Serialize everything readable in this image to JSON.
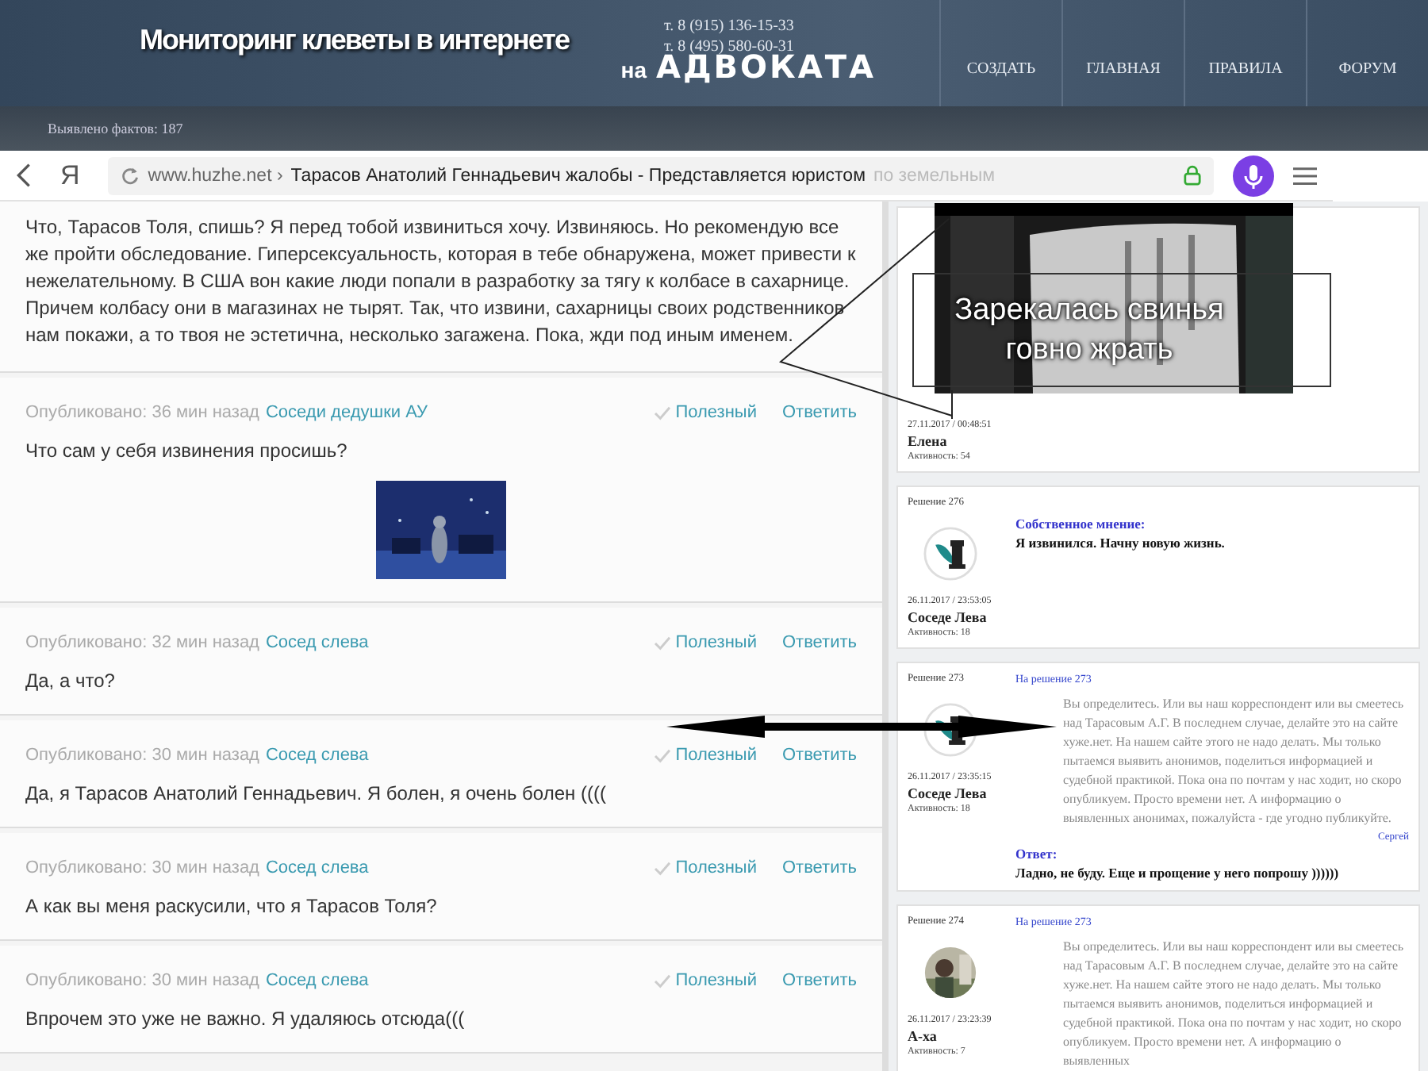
{
  "header": {
    "title": "Мониторинг клеветы в интернете",
    "subtitle_prefix": "на",
    "subtitle": "АДВОКАТА",
    "phones": [
      "т. 8 (915) 136-15-33",
      "т. 8 (495) 580-60-31"
    ],
    "nav": [
      {
        "label": "СОЗДАТЬ"
      },
      {
        "label": "ГЛАВНАЯ"
      },
      {
        "label": "ПРАВИЛА"
      },
      {
        "label": "ФОРУМ"
      }
    ]
  },
  "stats_bar": {
    "text": "Выявлено фактов: 187"
  },
  "browser": {
    "logo": "Я",
    "domain": "www.huzhe.net ›",
    "page_title": "Тарасов Анатолий Геннадьевич жалобы - Представляется юристом",
    "page_title_faded": "по земельным"
  },
  "excerpt": "Что, Тарасов Толя, спишь? Я перед тобой извиниться хочу. Извиняюсь. Но рекомендую все же пройти обследование. Гиперсексуальность, которая в тебе обнаружена, может привести к нежелательному. В США вон какие люди попали в разработку за тягу к колбасе в сахарнице. Причем колбасу они в магазинах не тырят. Так, что извини, сахарницы своих родственников нам покажи, а то твоя не эстетична, несколько загажена. Пока, жди под иным именем.",
  "comments": [
    {
      "published": "Опубликовано: 36 мин назад",
      "author": "Соседи дедушки АУ",
      "useful": "Полезный",
      "reply": "Ответить",
      "text": "Что сам у себя извинения просишь?"
    },
    {
      "published": "Опубликовано: 32 мин назад",
      "author": "Сосед слева",
      "useful": "Полезный",
      "reply": "Ответить",
      "text": "Да, а что?"
    },
    {
      "published": "Опубликовано: 30 мин назад",
      "author": "Сосед слева",
      "useful": "Полезный",
      "reply": "Ответить",
      "text": "Да, я Тарасов Анатолий Геннадьевич. Я болен, я очень болен (((("
    },
    {
      "published": "Опубликовано: 30 мин назад",
      "author": "Сосед слева",
      "useful": "Полезный",
      "reply": "Ответить",
      "text": "А как вы меня раскусили, что я Тарасов Толя?"
    },
    {
      "published": "Опубликовано: 30 мин назад",
      "author": "Сосед слева",
      "useful": "Полезный",
      "reply": "Ответить",
      "text": "Впрочем это уже не важно. Я удаляюсь отсюда((("
    }
  ],
  "forum": [
    {
      "date": "27.11.2017 / 00:48:51",
      "name": "Елена",
      "activity": "Активность: 54"
    },
    {
      "decision": "Решение 276",
      "avatar": {
        "kind": "quill"
      },
      "opinion_label": "Собственное мнение:",
      "opinion": "Я извинился. Начну новую жизнь.",
      "date": "26.11.2017 / 23:53:05",
      "name": "Соседе Лева",
      "activity": "Активность: 18"
    },
    {
      "decision": "Решение 273",
      "reply_to": "На решение 273",
      "avatar": {
        "kind": "quill"
      },
      "body": "Вы определитесь. Или вы наш корреспондент или вы смеетесь над Тарасовым А.Г. В последнем случае, делайте это на сайте хуже.нет. На нашем сайте этого не надо делать. Мы только пытаемся выявить анонимов, поделиться информацией и судебной практикой. Пока она по почтам у нас ходит, но скоро опубликуем. Просто времени нет. А информацию о выявленных анонимах, пожалуйста - где угодно публикуйте.",
      "signature": "Сергей",
      "answer_label": "Ответ:",
      "answer": "Ладно, не буду. Еще и прощение у него попрошу ))))))",
      "date": "26.11.2017 / 23:35:15",
      "name": "Соседе Лева",
      "activity": "Активность: 18"
    },
    {
      "decision": "Решение 274",
      "reply_to": "На решение 273",
      "body": "Вы определитесь. Или вы наш корреспондент или вы смеетесь над Тарасовым А.Г. В последнем случае, делайте это на сайте хуже.нет. На нашем сайте этого не надо делать. Мы только пытаемся выявить анонимов, поделиться информацией и судебной практикой. Пока она по почтам у нас ходит, но скоро опубликуем. Просто времени нет. А информацию о выявленных",
      "date": "26.11.2017 / 23:23:39",
      "name": "А-ха",
      "activity": "Активность: 7"
    }
  ],
  "overlay": {
    "caption": "Зарекалась свинья говно жрать"
  }
}
